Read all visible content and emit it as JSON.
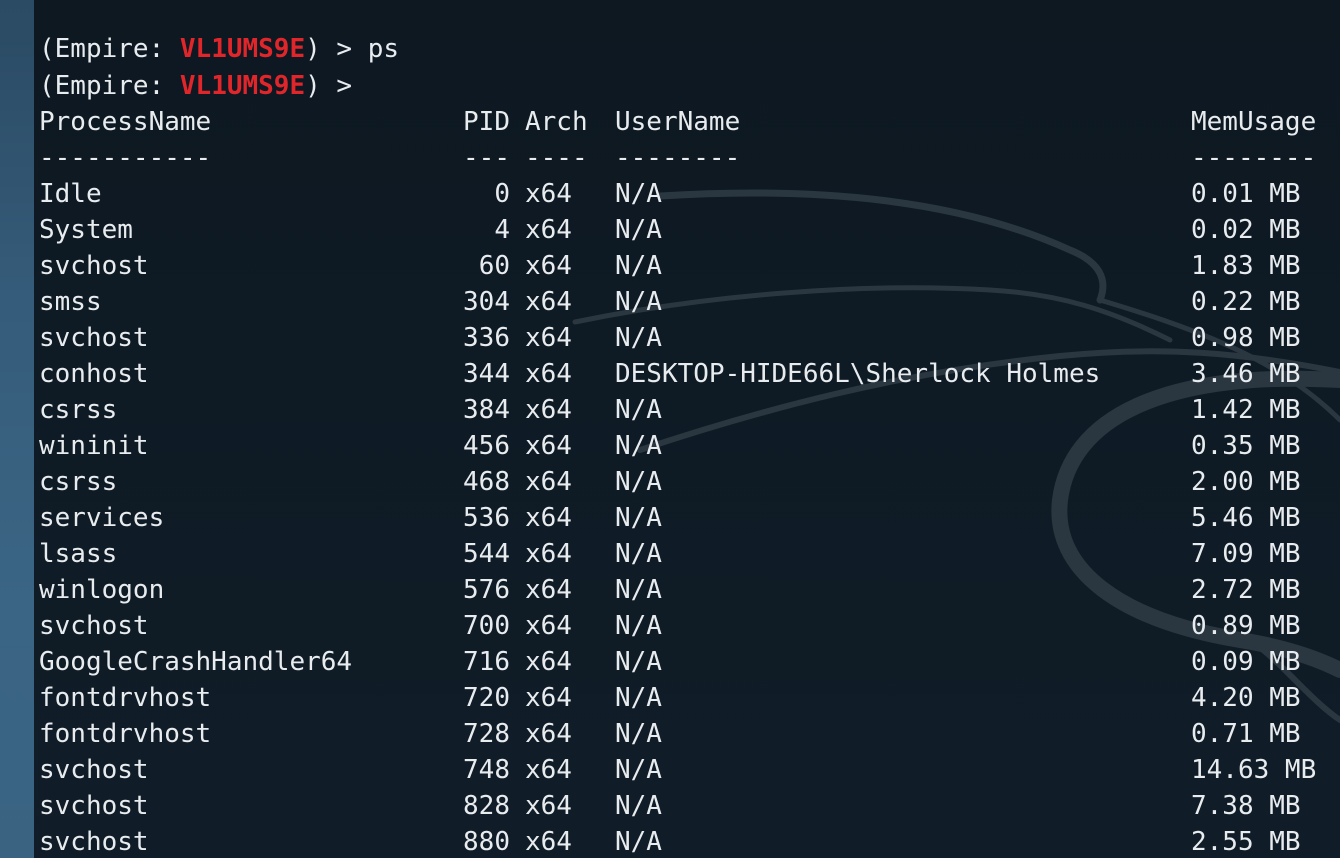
{
  "terminal": {
    "prompt_prefix": "(Empire: ",
    "session_id": "VL1UMS9E",
    "prompt_suffix": ") > ",
    "commands": [
      "ps",
      ""
    ],
    "accent_color": "#e0262a"
  },
  "process_table": {
    "headers": [
      "ProcessName",
      "PID",
      "Arch",
      "UserName",
      "MemUsage"
    ],
    "separators": [
      "-----------",
      "---",
      "----",
      "--------",
      "--------"
    ],
    "rows": [
      {
        "name": "Idle",
        "pid": "0",
        "arch": "x64",
        "user": "N/A",
        "mem": "0.01 MB"
      },
      {
        "name": "System",
        "pid": "4",
        "arch": "x64",
        "user": "N/A",
        "mem": "0.02 MB"
      },
      {
        "name": "svchost",
        "pid": "60",
        "arch": "x64",
        "user": "N/A",
        "mem": "1.83 MB"
      },
      {
        "name": "smss",
        "pid": "304",
        "arch": "x64",
        "user": "N/A",
        "mem": "0.22 MB"
      },
      {
        "name": "svchost",
        "pid": "336",
        "arch": "x64",
        "user": "N/A",
        "mem": "0.98 MB"
      },
      {
        "name": "conhost",
        "pid": "344",
        "arch": "x64",
        "user": "DESKTOP-HIDE66L\\Sherlock Holmes",
        "mem": "3.46 MB"
      },
      {
        "name": "csrss",
        "pid": "384",
        "arch": "x64",
        "user": "N/A",
        "mem": "1.42 MB"
      },
      {
        "name": "wininit",
        "pid": "456",
        "arch": "x64",
        "user": "N/A",
        "mem": "0.35 MB"
      },
      {
        "name": "csrss",
        "pid": "468",
        "arch": "x64",
        "user": "N/A",
        "mem": "2.00 MB"
      },
      {
        "name": "services",
        "pid": "536",
        "arch": "x64",
        "user": "N/A",
        "mem": "5.46 MB"
      },
      {
        "name": "lsass",
        "pid": "544",
        "arch": "x64",
        "user": "N/A",
        "mem": "7.09 MB"
      },
      {
        "name": "winlogon",
        "pid": "576",
        "arch": "x64",
        "user": "N/A",
        "mem": "2.72 MB"
      },
      {
        "name": "svchost",
        "pid": "700",
        "arch": "x64",
        "user": "N/A",
        "mem": "0.89 MB"
      },
      {
        "name": "GoogleCrashHandler64",
        "pid": "716",
        "arch": "x64",
        "user": "N/A",
        "mem": "0.09 MB"
      },
      {
        "name": "fontdrvhost",
        "pid": "720",
        "arch": "x64",
        "user": "N/A",
        "mem": "4.20 MB"
      },
      {
        "name": "fontdrvhost",
        "pid": "728",
        "arch": "x64",
        "user": "N/A",
        "mem": "0.71 MB"
      },
      {
        "name": "svchost",
        "pid": "748",
        "arch": "x64",
        "user": "N/A",
        "mem": "14.63 MB"
      },
      {
        "name": "svchost",
        "pid": "828",
        "arch": "x64",
        "user": "N/A",
        "mem": "7.38 MB"
      },
      {
        "name": "svchost",
        "pid": "880",
        "arch": "x64",
        "user": "N/A",
        "mem": "2.55 MB"
      }
    ]
  }
}
